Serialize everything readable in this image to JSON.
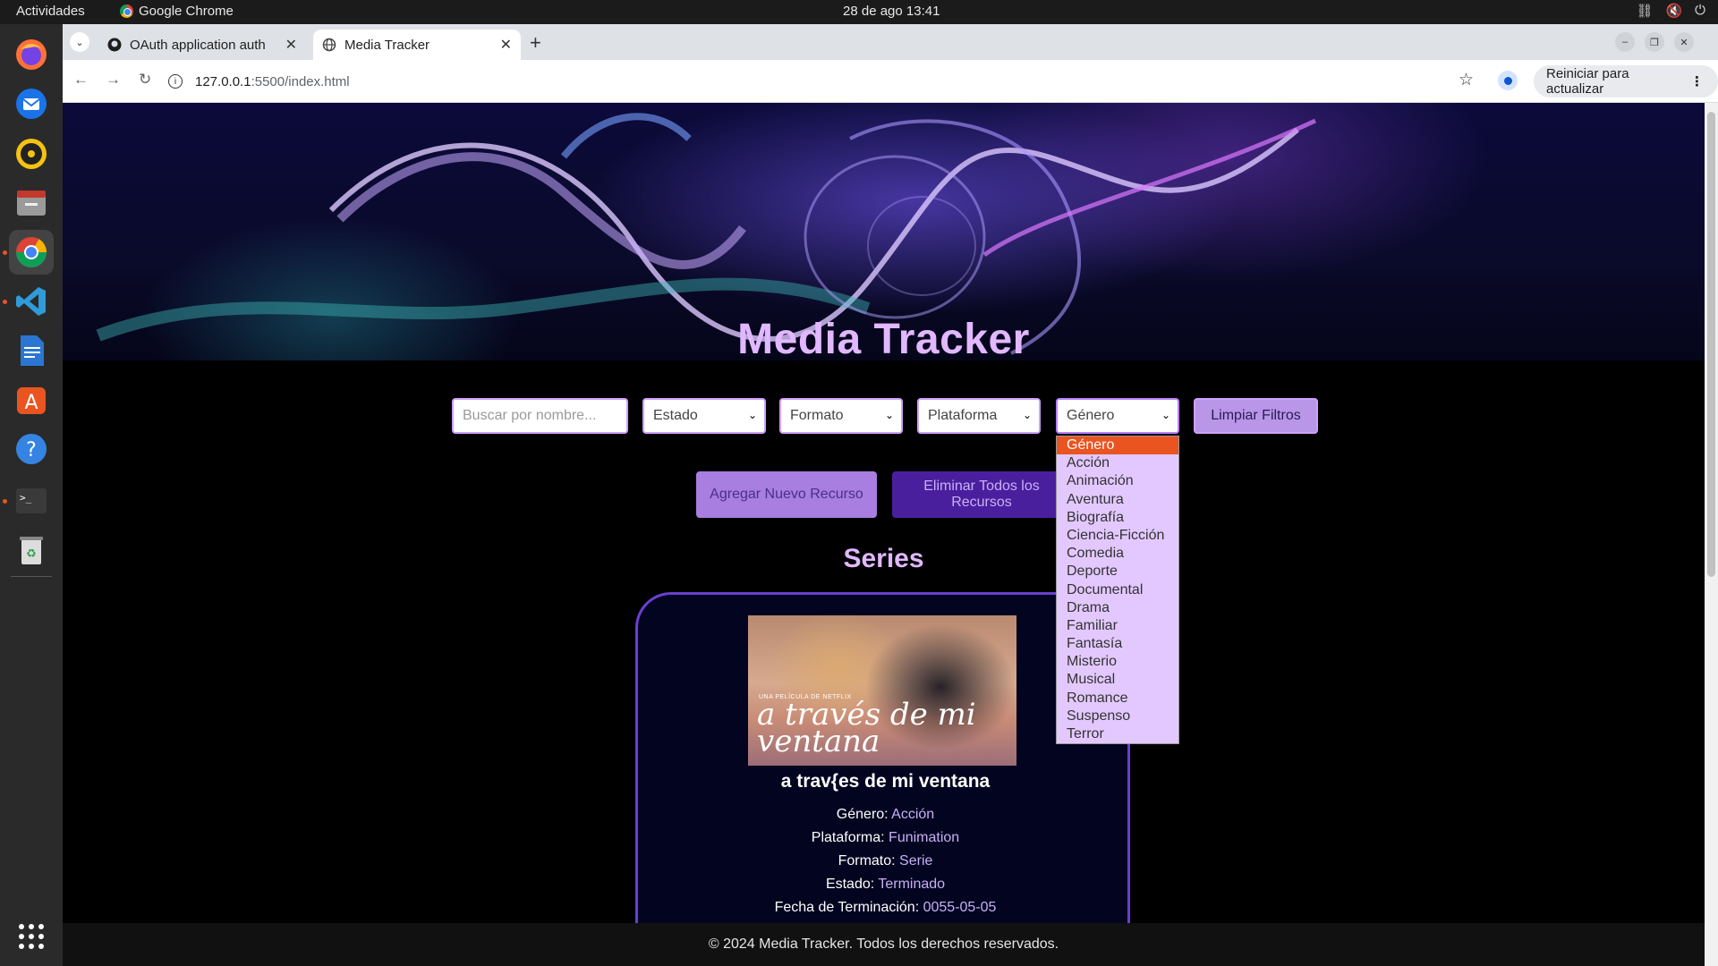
{
  "system_bar": {
    "activities": "Actividades",
    "app_name": "Google Chrome",
    "clock": "28 de ago  13:41"
  },
  "dock": {
    "apps": [
      "firefox-icon",
      "thunderbird-icon",
      "rhythmbox-icon",
      "files-icon",
      "chrome-icon",
      "vscode-icon",
      "writer-icon",
      "app-center-icon",
      "help-icon",
      "terminal-icon",
      "trash-icon",
      "show-apps-icon"
    ]
  },
  "browser": {
    "tabs": [
      {
        "title": "OAuth application auth",
        "active": false
      },
      {
        "title": "Media Tracker",
        "active": true
      }
    ],
    "url_host": "127.0.0.1",
    "url_path": ":5500/index.html",
    "relaunch_label": "Reiniciar para actualizar"
  },
  "page": {
    "title": "Media Tracker",
    "search_placeholder": "Buscar por nombre...",
    "filters": {
      "estado": "Estado",
      "formato": "Formato",
      "plataforma": "Plataforma",
      "genero": "Género",
      "clear_label": "Limpiar Filtros"
    },
    "actions": {
      "add_label": "Agregar Nuevo Recurso",
      "delete_label": "Eliminar Todos los Recursos"
    },
    "section_title": "Series",
    "card": {
      "poster_small_text": "UNA PELÍCULA DE NETFLIX",
      "poster_title": "a través de mi ventana",
      "name": "a trav{es de mi ventana",
      "fields": [
        {
          "label": "Género:",
          "value": "Acción"
        },
        {
          "label": "Plataforma:",
          "value": "Funimation"
        },
        {
          "label": "Formato:",
          "value": "Serie"
        },
        {
          "label": "Estado:",
          "value": "Terminado"
        },
        {
          "label": "Fecha de Terminación:",
          "value": "0055-05-05"
        }
      ]
    },
    "genre_dropdown": {
      "options": [
        "Género",
        "Acción",
        "Animación",
        "Aventura",
        "Biografía",
        "Ciencia-Ficción",
        "Comedia",
        "Deporte",
        "Documental",
        "Drama",
        "Familiar",
        "Fantasía",
        "Misterio",
        "Musical",
        "Romance",
        "Suspenso",
        "Terror"
      ],
      "selected_index": 0
    },
    "footer": "© 2024 Media Tracker. Todos los derechos reservados."
  },
  "colors": {
    "accent_lilac": "#e1b8ff",
    "border_purple": "#cfa0ff",
    "delete_button": "#4a1f9e",
    "dropdown_highlight": "#e95420"
  }
}
